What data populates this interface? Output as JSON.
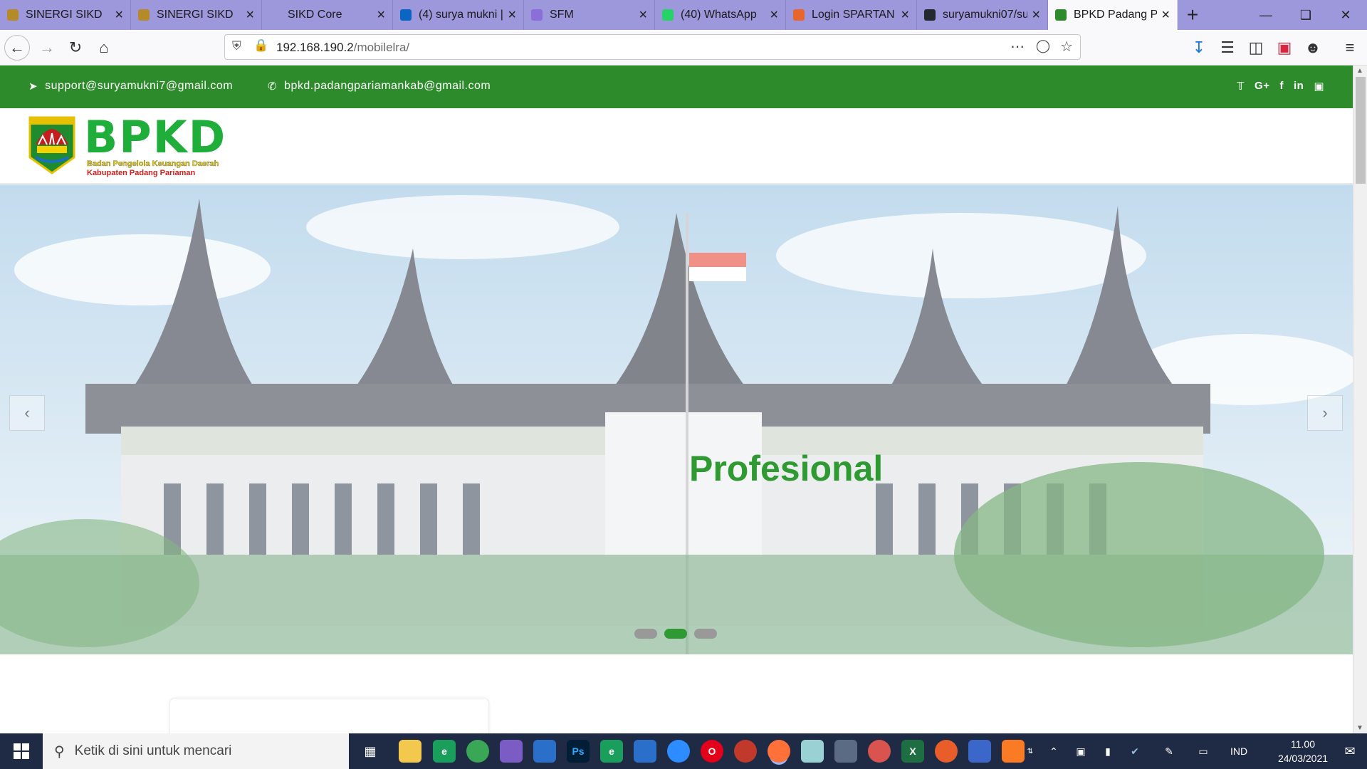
{
  "browser": {
    "tabs": [
      {
        "title": "SINERGI SIKD",
        "favicon": "sikd-crest",
        "color": "#b58b2a"
      },
      {
        "title": "SINERGI SIKD",
        "favicon": "sikd-crest",
        "color": "#b58b2a"
      },
      {
        "title": "SIKD Core",
        "favicon": "none",
        "color": "#9d97dc"
      },
      {
        "title": "(4) surya mukni |",
        "favicon": "linkedin",
        "color": "#0a66c2"
      },
      {
        "title": "SFM",
        "favicon": "sfm",
        "color": "#8a6fd8"
      },
      {
        "title": "(40) WhatsApp",
        "favicon": "whatsapp",
        "color": "#25d366"
      },
      {
        "title": "Login SPARTAN",
        "favicon": "spartan",
        "color": "#e8662c"
      },
      {
        "title": "suryamukni07/su",
        "favicon": "github",
        "color": "#24292e"
      },
      {
        "title": "BPKD Padang Pa",
        "favicon": "bpkd-crest",
        "color": "#2d8b2c"
      }
    ],
    "url_host": "192.168.190.2",
    "url_path": "/mobilelra/"
  },
  "topbar": {
    "email": "support@suryamukni7@gmail.com",
    "phone_email": "bpkd.padangpariamankab@gmail.com",
    "socials": [
      "twitter",
      "google-plus",
      "facebook",
      "linkedin",
      "instagram"
    ]
  },
  "logo": {
    "crest_label": "PADANG PARIAMAN",
    "title": "BPKD",
    "subtitle": "Badan Pengelola Keuangan Daerah",
    "region": "Kabupaten Padang Pariaman"
  },
  "hero": {
    "caption": "Profesional",
    "slides": 3,
    "active_slide": 1
  },
  "taskbar": {
    "search_placeholder": "Ketik di sini untuk mencari",
    "language": "IND",
    "time": "11.00",
    "date": "24/03/2021"
  },
  "colors": {
    "brand_green": "#2d8b2c",
    "tabbar": "#9d97dc"
  }
}
